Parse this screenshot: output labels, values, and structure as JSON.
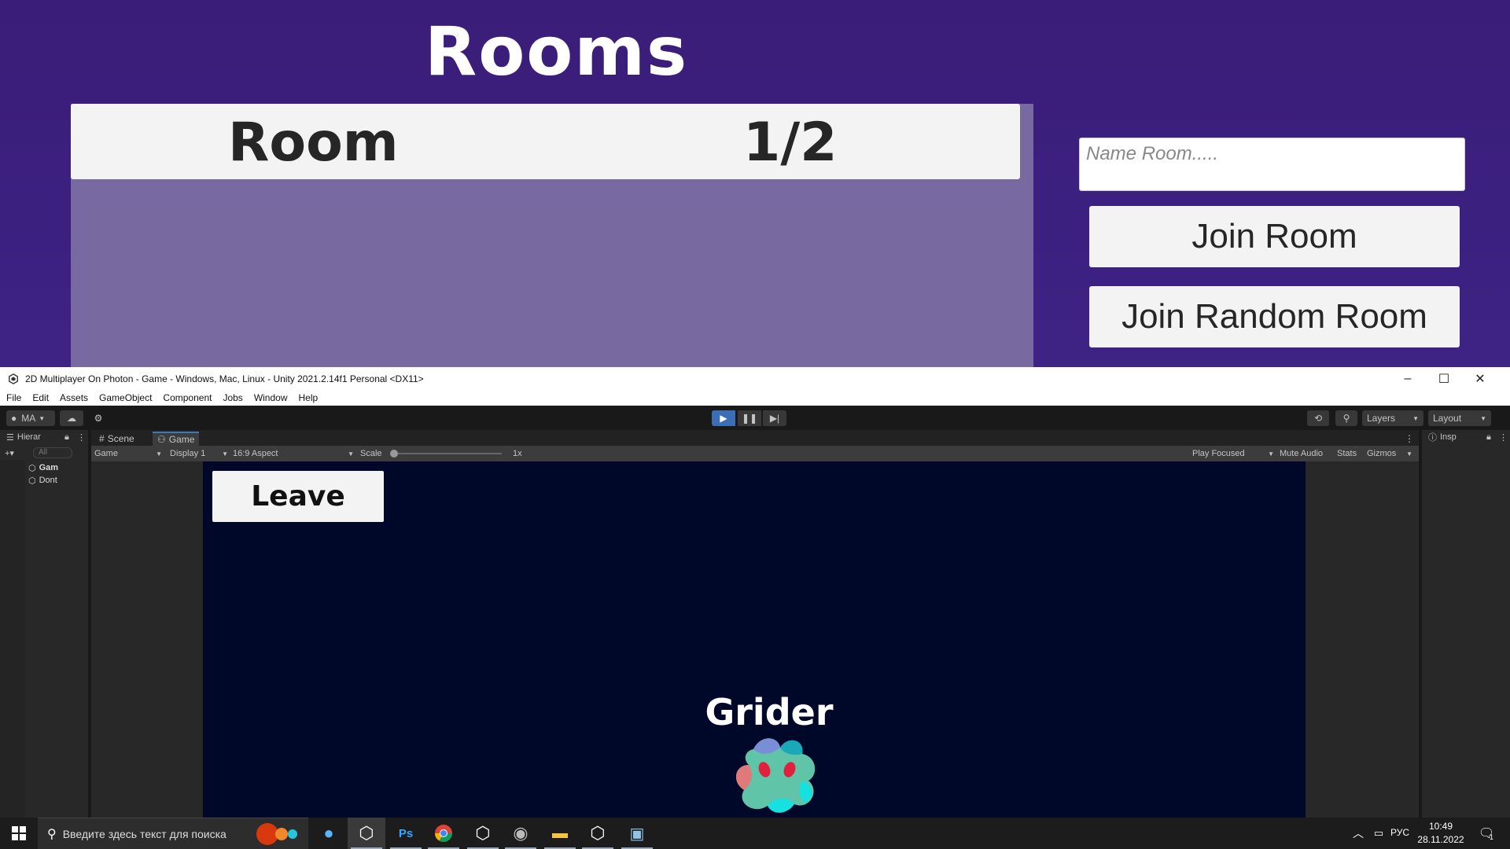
{
  "game_menu": {
    "title": "Rooms",
    "room_list": [
      {
        "name": "Room",
        "players": "1/2"
      }
    ],
    "name_input_placeholder": "Name Room.....",
    "join_room_label": "Join Room",
    "join_random_label": "Join Random Room"
  },
  "unity": {
    "window_title": "2D Multiplayer On Photon - Game - Windows, Mac, Linux - Unity 2021.2.14f1 Personal <DX11>",
    "menu": [
      "File",
      "Edit",
      "Assets",
      "GameObject",
      "Component",
      "Jobs",
      "Window",
      "Help"
    ],
    "toolbar": {
      "account_label": "MA",
      "layers_label": "Layers",
      "layout_label": "Layout"
    },
    "hierarchy": {
      "tab_label": "Hierar",
      "search_placeholder": "All",
      "items": [
        "Gam",
        "Dont"
      ]
    },
    "tabs": {
      "scene_label": "Scene",
      "game_label": "Game"
    },
    "game_toolbar": {
      "mode": "Game",
      "display": "Display 1",
      "aspect": "16:9 Aspect",
      "scale_label": "Scale",
      "scale_value": "1x",
      "play_focused": "Play Focused",
      "mute_audio": "Mute Audio",
      "stats": "Stats",
      "gizmos": "Gizmos"
    },
    "inspector_tab_label": "Insp",
    "game_view": {
      "leave_label": "Leave",
      "player_name": "Grider"
    }
  },
  "taskbar": {
    "search_placeholder": "Введите здесь текст для поиска",
    "language": "РУС",
    "time": "10:49",
    "date": "28.11.2022",
    "notification_count": "1"
  },
  "colors": {
    "menu_bg": "#3a1f80",
    "room_list_bg": "#786aa0",
    "game_view_bg": "#00082a",
    "play_active": "#3a6fb5"
  }
}
